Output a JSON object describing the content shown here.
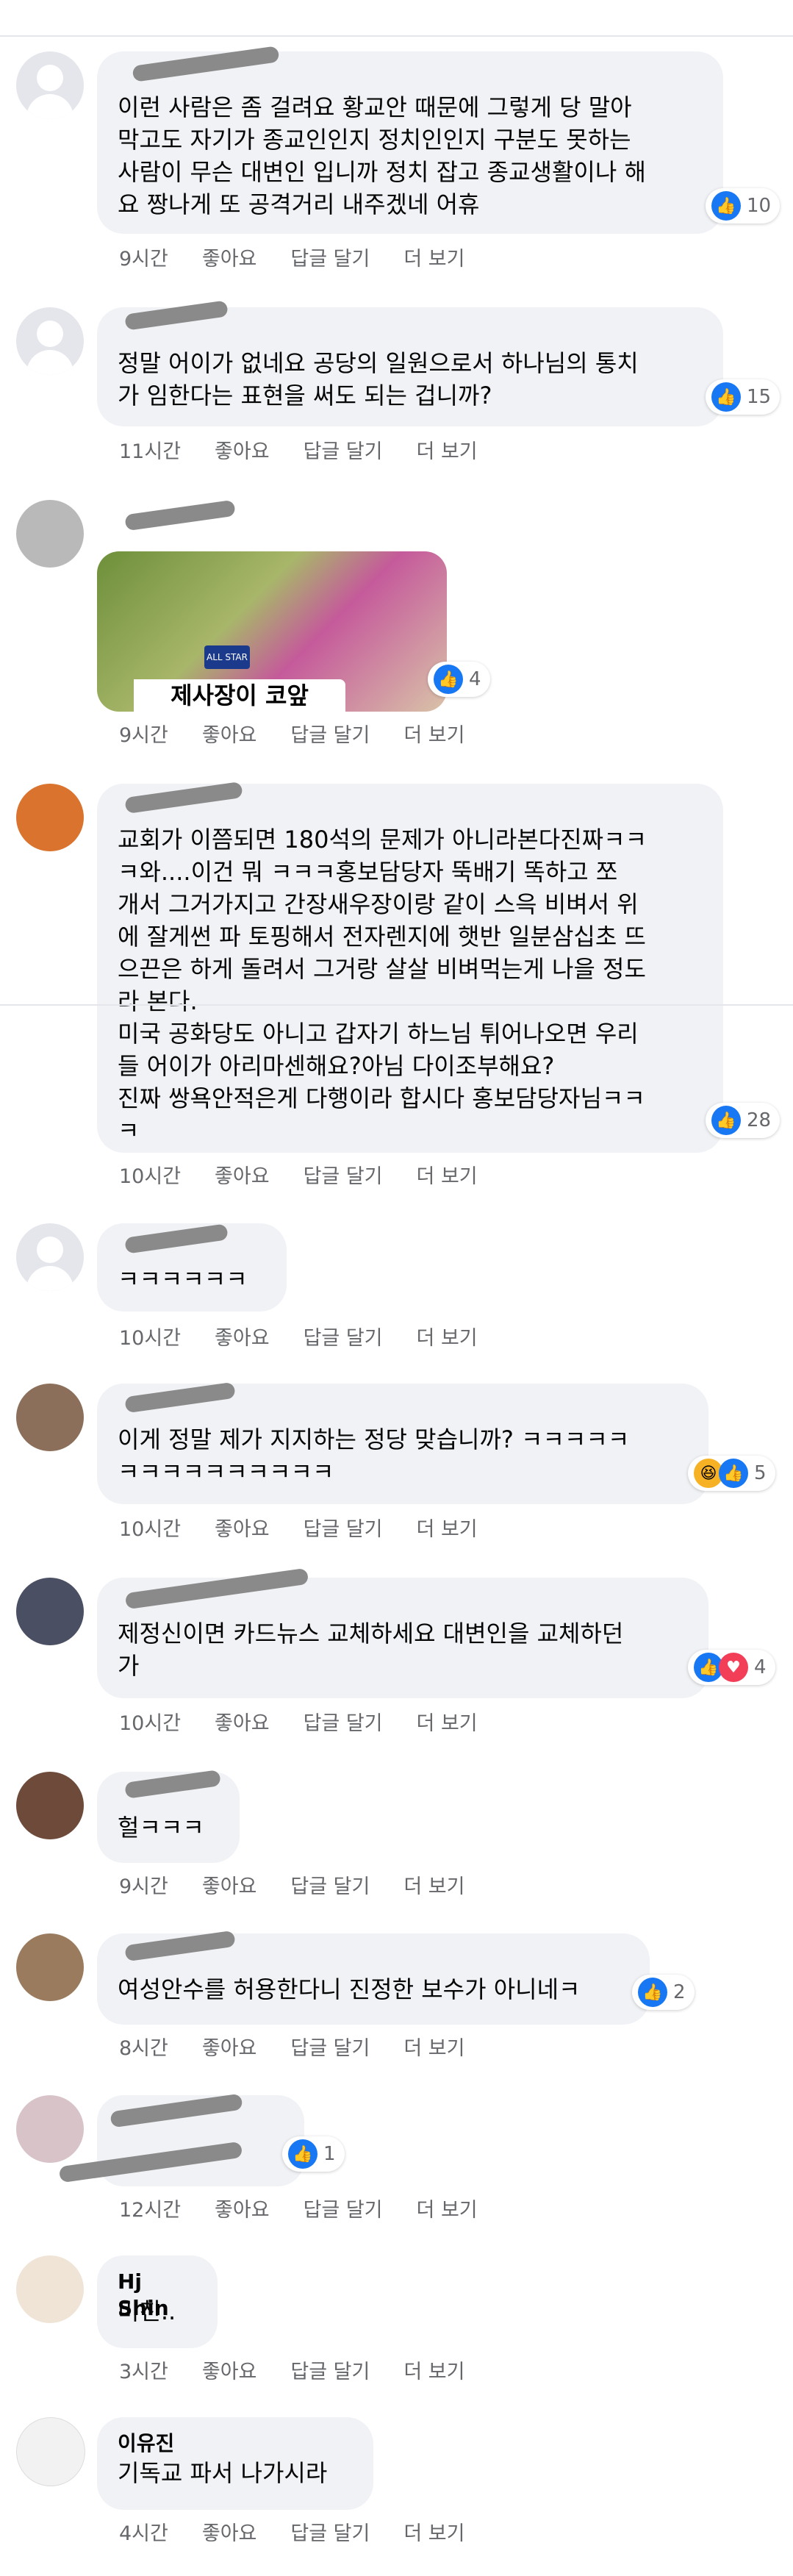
{
  "actions": {
    "like": "좋아요",
    "reply": "답글 달기",
    "more": "더 보기"
  },
  "comments": [
    {
      "author": "",
      "text": "이런 사람은 좀 걸려요 황교안 때문에 그렇게 당 말아\n막고도 자기가 종교인인지 정치인인지 구분도 못하는\n사람이 무슨 대변인 입니까 정치 잡고 종교생활이나 해\n요 짱나게 또 공격거리 내주겠네 어휴",
      "time": "9시간",
      "reactions": "10"
    },
    {
      "author": "",
      "text": "정말 어이가 없네요 공당의 일원으로서 하나님의 통치\n가 임한다는 표현을 써도 되는 겁니까?",
      "time": "11시간",
      "reactions": "15"
    },
    {
      "author": "",
      "image_caption": "제사장이 코앞",
      "image_badge": "ALL STAR",
      "time": "9시간",
      "reactions": "4"
    },
    {
      "author": "",
      "text": "교회가 이쯤되면 180석의 문제가 아니라본다진짜ㅋㅋ\nㅋ와....이건 뭐 ㅋㅋㅋ홍보담당자 뚝배기 똑하고 쪼\n개서 그거가지고 간장새우장이랑 같이 스윽 비벼서 위\n에 잘게썬 파 토핑해서 전자렌지에 햇반 일분삼십초 뜨\n으끈은 하게 돌려서 그거랑 살살 비벼먹는게 나을 정도\n라 본다.\n미국 공화당도 아니고 갑자기 하느님 튀어나오면 우리\n들 어이가 아리마센해요?아님 다이조부해요?\n진짜 쌍욕안적은게 다행이라 합시다 홍보담당자님ㅋㅋ\nㅋ",
      "time": "10시간",
      "reactions": "28"
    },
    {
      "author": "",
      "text": "ㅋㅋㅋㅋㅋㅋ",
      "time": "10시간",
      "reactions": ""
    },
    {
      "author": "",
      "text": "이게 정말 제가 지지하는 정당 맞습니까? ㅋㅋㅋㅋㅋ\nㅋㅋㅋㅋㅋㅋㅋㅋㅋㅋ",
      "time": "10시간",
      "reactions": "5"
    },
    {
      "author": "",
      "text": "제정신이면 카드뉴스 교체하세요 대변인을 교체하던\n가",
      "time": "10시간",
      "reactions": "4"
    },
    {
      "author": "",
      "text": "헐ㅋㅋㅋ",
      "time": "9시간",
      "reactions": ""
    },
    {
      "author": "",
      "text": "여성안수를 허용한다니 진정한 보수가 아니네ㅋ",
      "time": "8시간",
      "reactions": "2"
    },
    {
      "author": "",
      "text": "",
      "time": "12시간",
      "reactions": "1"
    },
    {
      "author": "Hj Shin",
      "text": "미친..",
      "time": "3시간",
      "reactions": ""
    },
    {
      "author": "이유진",
      "text": "기독교 파서 나가시라",
      "time": "4시간",
      "reactions": ""
    }
  ]
}
